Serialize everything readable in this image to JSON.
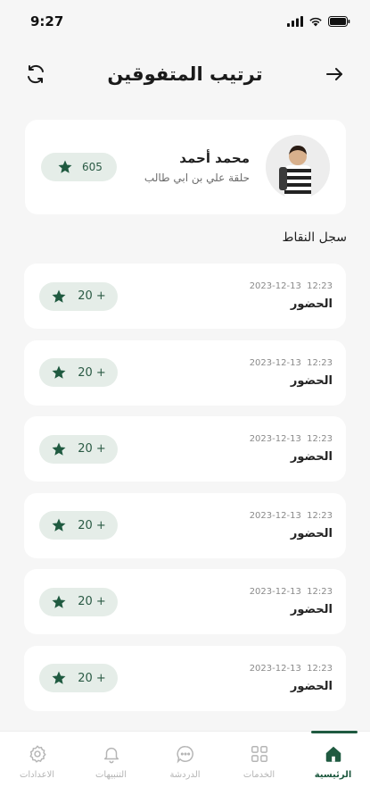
{
  "status": {
    "time": "9:27"
  },
  "header": {
    "title": "ترتيب المتفوقين"
  },
  "profile": {
    "name": "محمد أحمد",
    "circle": "حلقة علي بن ابي طالب",
    "points": "605"
  },
  "section": {
    "title": "سجل النقاط"
  },
  "records": [
    {
      "time": "12:23",
      "date": "2023-12-13",
      "title": "الحضور",
      "points": "20 +"
    },
    {
      "time": "12:23",
      "date": "2023-12-13",
      "title": "الحضور",
      "points": "20 +"
    },
    {
      "time": "12:23",
      "date": "2023-12-13",
      "title": "الحضور",
      "points": "20 +"
    },
    {
      "time": "12:23",
      "date": "2023-12-13",
      "title": "الحضور",
      "points": "20 +"
    },
    {
      "time": "12:23",
      "date": "2023-12-13",
      "title": "الحضور",
      "points": "20 +"
    },
    {
      "time": "12:23",
      "date": "2023-12-13",
      "title": "الحضور",
      "points": "20 +"
    }
  ],
  "nav": {
    "items": [
      {
        "label": "الرئيسية",
        "icon": "home-icon",
        "active": true
      },
      {
        "label": "الخدمات",
        "icon": "grid-icon",
        "active": false
      },
      {
        "label": "الدردشة",
        "icon": "chat-icon",
        "active": false
      },
      {
        "label": "التنبيهات",
        "icon": "bell-icon",
        "active": false
      },
      {
        "label": "الاعدادات",
        "icon": "gear-icon",
        "active": false
      }
    ]
  },
  "colors": {
    "accent": "#1f5a40",
    "pill": "#e5ede8",
    "background": "#f6f6f6"
  }
}
